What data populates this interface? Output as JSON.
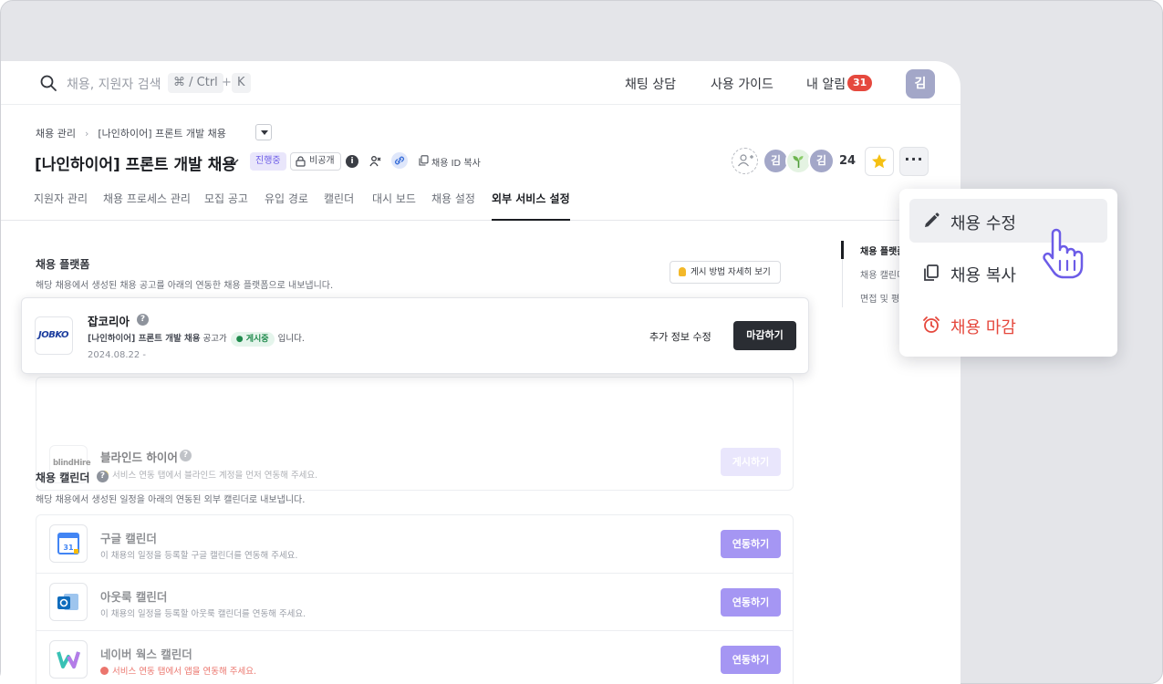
{
  "topbar": {
    "search_placeholder": "채용, 지원자 검색",
    "shortcut_key1": "⌘ / Ctrl",
    "shortcut_plus": "+",
    "shortcut_key2": "K",
    "chat": "채팅 상담",
    "guide": "사용 가이드",
    "notifications": "내 알림",
    "notification_count": "31",
    "avatar": "김"
  },
  "header": {
    "breadcrumb_root": "채용 관리",
    "breadcrumb_current": "[나인하이어] 프론트 개발 채용",
    "title": "[나인하이어] 프론트 개발 채용",
    "status_badge": "진행중",
    "visibility_badge": "비공개",
    "info_icon": "i",
    "copy_id": "채용 ID 복사",
    "members": [
      "김",
      "",
      "김"
    ],
    "member_count": "24"
  },
  "tabs": [
    "지원자 관리",
    "채용 프로세스 관리",
    "모집 공고",
    "유입 경로",
    "캘린더",
    "대시 보드",
    "채용 설정",
    "외부 서비스 설정"
  ],
  "active_tab": "외부 서비스 설정",
  "platform_section": {
    "title": "채용 플랫폼",
    "description": "해당 채용에서 생성된 채용 공고를 아래의 연동한 채용 플랫폼으로 내보냅니다.",
    "guide_button": "게시 방법 자세히 보기",
    "jobkorea": {
      "logo": "JOBKO",
      "name": "잡코리아",
      "help": "?",
      "line_posting": "[나인하이어] 프론트 개발 채용",
      "line_mid": "공고가",
      "status": "● 게시중",
      "line_end": "입니다.",
      "date": "2024.08.22 -",
      "extra_info": "추가 정보 수정",
      "close": "마감하기"
    },
    "blindhire": {
      "logo": "blindHire",
      "name": "블라인드 하이어",
      "help": "?",
      "warning": "서비스 연동 탭에서 블라인드 계정을 먼저 연동해 주세요.",
      "post": "게시하기"
    }
  },
  "calendar_section": {
    "title": "채용 캘린더",
    "help": "?",
    "description": "해당 채용에서 생성된 일정을 아래의 연동된 외부 캘린더로 내보냅니다.",
    "items": [
      {
        "name": "구글 캘린더",
        "desc": "이 채용의 일정을 등록할 구글 캘린더를 연동해 주세요.",
        "button": "연동하기"
      },
      {
        "name": "아웃룩 캘린더",
        "desc": "이 채용의 일정을 등록할 아웃룩 캘린더를 연동해 주세요.",
        "button": "연동하기"
      },
      {
        "name": "네이버 웍스 캘린더",
        "desc": "서비스 연동 탭에서 앱을 연동해 주세요.",
        "button": "연동하기"
      }
    ],
    "google_icon_text": "31"
  },
  "side_nav": [
    "채용 플랫폼",
    "채용 캘린더",
    "면접 및 평"
  ],
  "menu": {
    "edit": "채용 수정",
    "copy": "채용 복사",
    "close": "채용 마감"
  },
  "colors": {
    "accent": "#6c5ce7",
    "danger": "#e5483d",
    "link_button": "#a596f3",
    "dark_button": "#2a2d33"
  }
}
